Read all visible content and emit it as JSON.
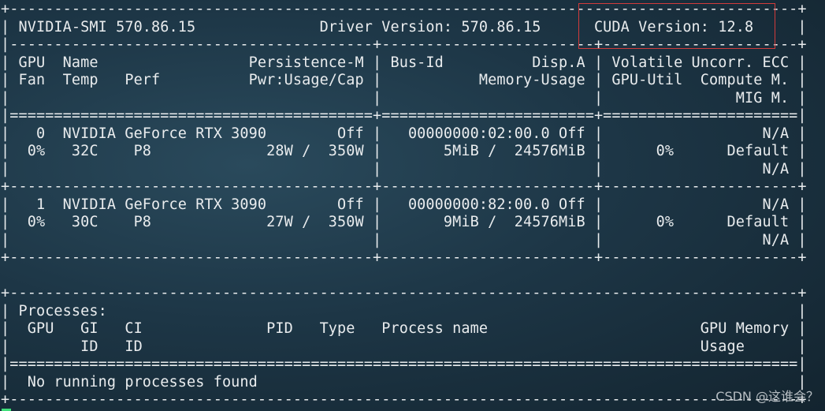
{
  "terminal": {
    "lines": [
      "+-----------------------------------------------------------------------------------------+",
      "| NVIDIA-SMI 570.86.15              Driver Version: 570.86.15      CUDA Version: 12.8     |",
      "|-----------------------------------------+------------------------+----------------------+",
      "| GPU  Name                 Persistence-M | Bus-Id          Disp.A | Volatile Uncorr. ECC |",
      "| Fan  Temp   Perf          Pwr:Usage/Cap |           Memory-Usage | GPU-Util  Compute M. |",
      "|                                         |                        |               MIG M. |",
      "|=========================================+========================+======================|",
      "|   0  NVIDIA GeForce RTX 3090        Off |   00000000:02:00.0 Off |                  N/A |",
      "|  0%   32C    P8             28W /  350W |       5MiB /  24576MiB |      0%      Default |",
      "|                                         |                        |                  N/A |",
      "+-----------------------------------------+------------------------+----------------------+",
      "|   1  NVIDIA GeForce RTX 3090        Off |   00000000:82:00.0 Off |                  N/A |",
      "|  0%   30C    P8             27W /  350W |       9MiB /  24576MiB |      0%      Default |",
      "|                                         |                        |                  N/A |",
      "+-----------------------------------------+------------------------+----------------------+",
      "",
      "+-----------------------------------------------------------------------------------------+",
      "| Processes:                                                                              |",
      "|  GPU   GI   CI              PID   Type   Process name                        GPU Memory |",
      "|        ID   ID                                                               Usage      |",
      "|=========================================================================================|",
      "|  No running processes found                                                             |",
      "+-----------------------------------------------------------------------------------------+"
    ]
  },
  "colors": {
    "highlight_box": "#d23b3b",
    "cursor": "#3fe07a"
  },
  "watermark": "CSDN @这谁会？"
}
